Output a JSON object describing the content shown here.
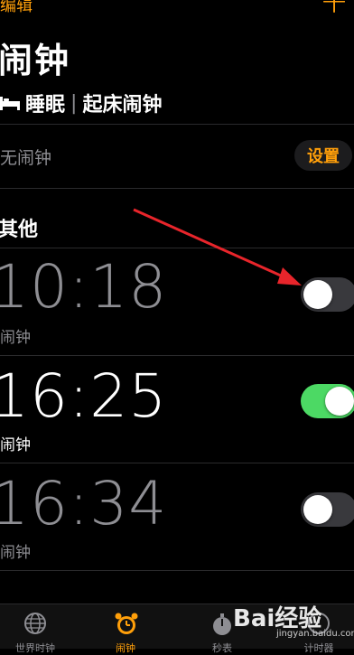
{
  "nav": {
    "edit_label": "编辑",
    "add_label": "+"
  },
  "page_title": "闹钟",
  "sleep": {
    "label": "睡眠",
    "separator": "|",
    "wake_label": "起床闹钟"
  },
  "no_alarm": {
    "text": "无闹钟",
    "setup_label": "设置"
  },
  "section_title": "其他",
  "alarms": [
    {
      "time": "10:18",
      "label": "闹钟",
      "enabled": false
    },
    {
      "time": "16:25",
      "label": "闹钟",
      "enabled": true
    },
    {
      "time": "16:34",
      "label": "闹钟",
      "enabled": false
    }
  ],
  "tabs": [
    {
      "label": "世界时钟",
      "icon": "globe-icon",
      "active": false
    },
    {
      "label": "闹钟",
      "icon": "alarm-clock-icon",
      "active": true
    },
    {
      "label": "秒表",
      "icon": "stopwatch-icon",
      "active": false
    },
    {
      "label": "计时器",
      "icon": "timer-icon",
      "active": false
    }
  ],
  "watermark": {
    "text": "Bai经验",
    "sub": "jingyan.baidu.com"
  },
  "colors": {
    "accent": "#ff9f0a",
    "toggle_on": "#4cd964",
    "arrow": "#e8252b",
    "background": "#000000"
  }
}
